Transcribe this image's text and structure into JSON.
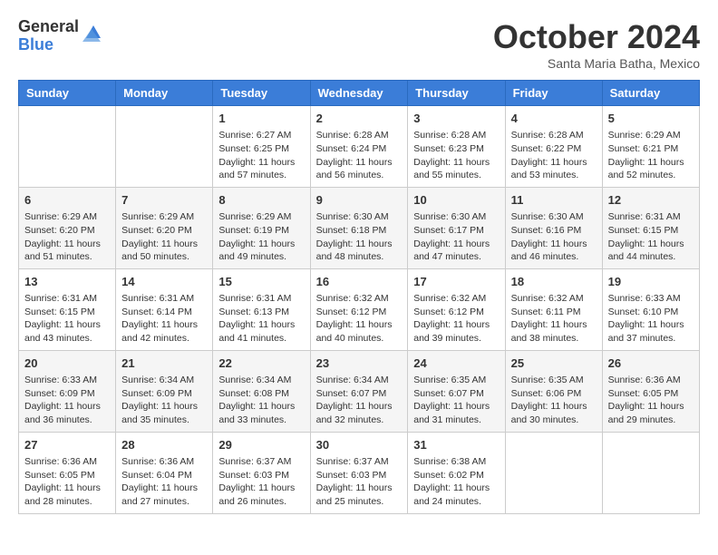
{
  "header": {
    "logo_general": "General",
    "logo_blue": "Blue",
    "month_title": "October 2024",
    "location": "Santa Maria Batha, Mexico"
  },
  "days_of_week": [
    "Sunday",
    "Monday",
    "Tuesday",
    "Wednesday",
    "Thursday",
    "Friday",
    "Saturday"
  ],
  "weeks": [
    [
      {
        "day": "",
        "sunrise": "",
        "sunset": "",
        "daylight": ""
      },
      {
        "day": "",
        "sunrise": "",
        "sunset": "",
        "daylight": ""
      },
      {
        "day": "1",
        "sunrise": "Sunrise: 6:27 AM",
        "sunset": "Sunset: 6:25 PM",
        "daylight": "Daylight: 11 hours and 57 minutes."
      },
      {
        "day": "2",
        "sunrise": "Sunrise: 6:28 AM",
        "sunset": "Sunset: 6:24 PM",
        "daylight": "Daylight: 11 hours and 56 minutes."
      },
      {
        "day": "3",
        "sunrise": "Sunrise: 6:28 AM",
        "sunset": "Sunset: 6:23 PM",
        "daylight": "Daylight: 11 hours and 55 minutes."
      },
      {
        "day": "4",
        "sunrise": "Sunrise: 6:28 AM",
        "sunset": "Sunset: 6:22 PM",
        "daylight": "Daylight: 11 hours and 53 minutes."
      },
      {
        "day": "5",
        "sunrise": "Sunrise: 6:29 AM",
        "sunset": "Sunset: 6:21 PM",
        "daylight": "Daylight: 11 hours and 52 minutes."
      }
    ],
    [
      {
        "day": "6",
        "sunrise": "Sunrise: 6:29 AM",
        "sunset": "Sunset: 6:20 PM",
        "daylight": "Daylight: 11 hours and 51 minutes."
      },
      {
        "day": "7",
        "sunrise": "Sunrise: 6:29 AM",
        "sunset": "Sunset: 6:20 PM",
        "daylight": "Daylight: 11 hours and 50 minutes."
      },
      {
        "day": "8",
        "sunrise": "Sunrise: 6:29 AM",
        "sunset": "Sunset: 6:19 PM",
        "daylight": "Daylight: 11 hours and 49 minutes."
      },
      {
        "day": "9",
        "sunrise": "Sunrise: 6:30 AM",
        "sunset": "Sunset: 6:18 PM",
        "daylight": "Daylight: 11 hours and 48 minutes."
      },
      {
        "day": "10",
        "sunrise": "Sunrise: 6:30 AM",
        "sunset": "Sunset: 6:17 PM",
        "daylight": "Daylight: 11 hours and 47 minutes."
      },
      {
        "day": "11",
        "sunrise": "Sunrise: 6:30 AM",
        "sunset": "Sunset: 6:16 PM",
        "daylight": "Daylight: 11 hours and 46 minutes."
      },
      {
        "day": "12",
        "sunrise": "Sunrise: 6:31 AM",
        "sunset": "Sunset: 6:15 PM",
        "daylight": "Daylight: 11 hours and 44 minutes."
      }
    ],
    [
      {
        "day": "13",
        "sunrise": "Sunrise: 6:31 AM",
        "sunset": "Sunset: 6:15 PM",
        "daylight": "Daylight: 11 hours and 43 minutes."
      },
      {
        "day": "14",
        "sunrise": "Sunrise: 6:31 AM",
        "sunset": "Sunset: 6:14 PM",
        "daylight": "Daylight: 11 hours and 42 minutes."
      },
      {
        "day": "15",
        "sunrise": "Sunrise: 6:31 AM",
        "sunset": "Sunset: 6:13 PM",
        "daylight": "Daylight: 11 hours and 41 minutes."
      },
      {
        "day": "16",
        "sunrise": "Sunrise: 6:32 AM",
        "sunset": "Sunset: 6:12 PM",
        "daylight": "Daylight: 11 hours and 40 minutes."
      },
      {
        "day": "17",
        "sunrise": "Sunrise: 6:32 AM",
        "sunset": "Sunset: 6:12 PM",
        "daylight": "Daylight: 11 hours and 39 minutes."
      },
      {
        "day": "18",
        "sunrise": "Sunrise: 6:32 AM",
        "sunset": "Sunset: 6:11 PM",
        "daylight": "Daylight: 11 hours and 38 minutes."
      },
      {
        "day": "19",
        "sunrise": "Sunrise: 6:33 AM",
        "sunset": "Sunset: 6:10 PM",
        "daylight": "Daylight: 11 hours and 37 minutes."
      }
    ],
    [
      {
        "day": "20",
        "sunrise": "Sunrise: 6:33 AM",
        "sunset": "Sunset: 6:09 PM",
        "daylight": "Daylight: 11 hours and 36 minutes."
      },
      {
        "day": "21",
        "sunrise": "Sunrise: 6:34 AM",
        "sunset": "Sunset: 6:09 PM",
        "daylight": "Daylight: 11 hours and 35 minutes."
      },
      {
        "day": "22",
        "sunrise": "Sunrise: 6:34 AM",
        "sunset": "Sunset: 6:08 PM",
        "daylight": "Daylight: 11 hours and 33 minutes."
      },
      {
        "day": "23",
        "sunrise": "Sunrise: 6:34 AM",
        "sunset": "Sunset: 6:07 PM",
        "daylight": "Daylight: 11 hours and 32 minutes."
      },
      {
        "day": "24",
        "sunrise": "Sunrise: 6:35 AM",
        "sunset": "Sunset: 6:07 PM",
        "daylight": "Daylight: 11 hours and 31 minutes."
      },
      {
        "day": "25",
        "sunrise": "Sunrise: 6:35 AM",
        "sunset": "Sunset: 6:06 PM",
        "daylight": "Daylight: 11 hours and 30 minutes."
      },
      {
        "day": "26",
        "sunrise": "Sunrise: 6:36 AM",
        "sunset": "Sunset: 6:05 PM",
        "daylight": "Daylight: 11 hours and 29 minutes."
      }
    ],
    [
      {
        "day": "27",
        "sunrise": "Sunrise: 6:36 AM",
        "sunset": "Sunset: 6:05 PM",
        "daylight": "Daylight: 11 hours and 28 minutes."
      },
      {
        "day": "28",
        "sunrise": "Sunrise: 6:36 AM",
        "sunset": "Sunset: 6:04 PM",
        "daylight": "Daylight: 11 hours and 27 minutes."
      },
      {
        "day": "29",
        "sunrise": "Sunrise: 6:37 AM",
        "sunset": "Sunset: 6:03 PM",
        "daylight": "Daylight: 11 hours and 26 minutes."
      },
      {
        "day": "30",
        "sunrise": "Sunrise: 6:37 AM",
        "sunset": "Sunset: 6:03 PM",
        "daylight": "Daylight: 11 hours and 25 minutes."
      },
      {
        "day": "31",
        "sunrise": "Sunrise: 6:38 AM",
        "sunset": "Sunset: 6:02 PM",
        "daylight": "Daylight: 11 hours and 24 minutes."
      },
      {
        "day": "",
        "sunrise": "",
        "sunset": "",
        "daylight": ""
      },
      {
        "day": "",
        "sunrise": "",
        "sunset": "",
        "daylight": ""
      }
    ]
  ]
}
